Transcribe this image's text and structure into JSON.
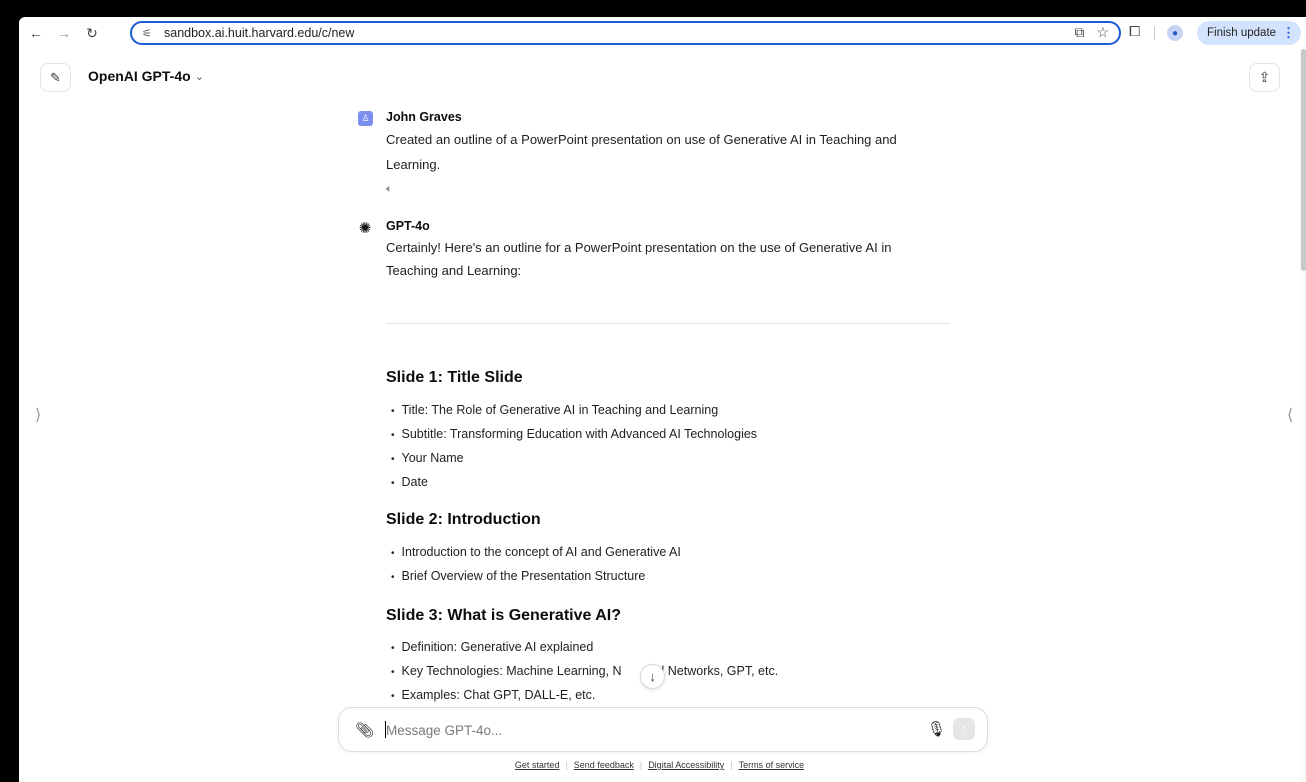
{
  "browser": {
    "url": "sandbox.ai.huit.harvard.edu/c/new",
    "finish_update_label": "Finish update"
  },
  "header": {
    "model_name": "OpenAI GPT-4o"
  },
  "conversation": {
    "user": {
      "name": "John Graves",
      "message_line1": "Created an outline of a PowerPoint presentation on use of Generative AI in Teaching and",
      "message_line2": "Learning."
    },
    "assistant": {
      "name": "GPT-4o",
      "intro_line1": "Certainly! Here's an outline for a PowerPoint presentation on the use of Generative AI in",
      "intro_line2": "Teaching and Learning:"
    },
    "slides": [
      {
        "heading": "Slide 1: Title Slide",
        "bullets": [
          "Title: The Role of Generative AI in Teaching and Learning",
          "Subtitle: Transforming Education with Advanced AI Technologies",
          "Your Name",
          "Date"
        ]
      },
      {
        "heading": "Slide 2: Introduction",
        "bullets": [
          "Introduction to the concept of AI and Generative AI",
          "Brief Overview of the Presentation Structure"
        ]
      },
      {
        "heading": "Slide 3: What is Generative AI?",
        "bullets": [
          "Definition: Generative AI explained",
          "Key Technologies: Machine Learning, N",
          "al Networks, GPT, etc.",
          "Examples: Chat GPT, DALL-E, etc."
        ]
      }
    ]
  },
  "composer": {
    "placeholder": "Message GPT-4o..."
  },
  "footer": {
    "links": [
      "Get started",
      "Send feedback",
      "Digital Accessibility",
      "Terms of service"
    ]
  }
}
